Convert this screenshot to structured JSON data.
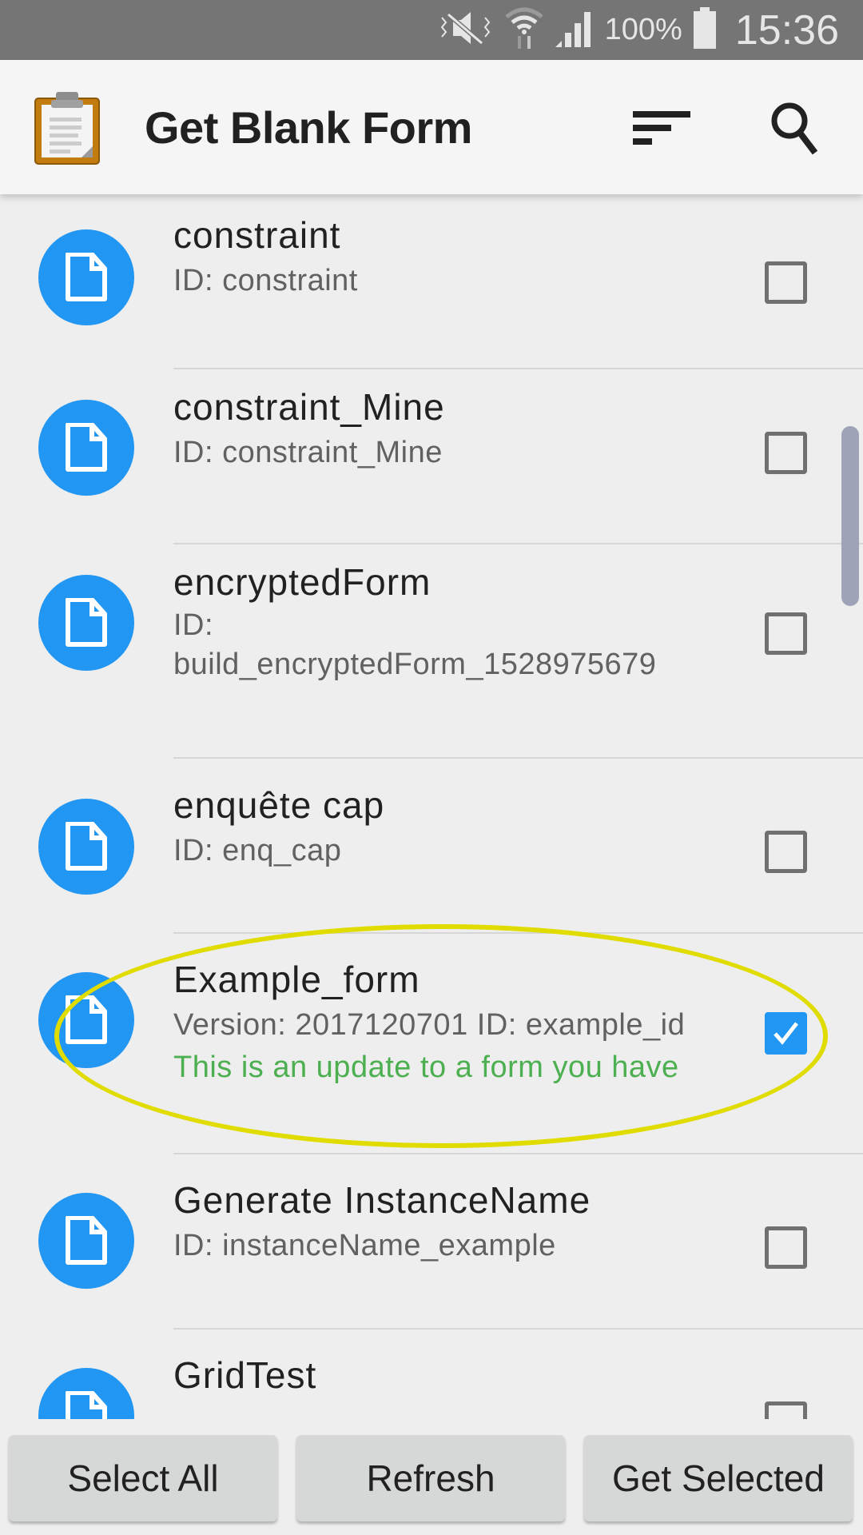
{
  "status_bar": {
    "icons": [
      "vibrate-mute-icon",
      "wifi-icon",
      "signal-icon",
      "battery-icon"
    ],
    "battery": "100%",
    "time": "15:36"
  },
  "app_bar": {
    "title": "Get Blank Form",
    "icon": "clipboard-icon",
    "actions": [
      "sort-icon",
      "search-icon"
    ]
  },
  "forms": [
    {
      "name": "constraint",
      "detail": "ID: constraint",
      "checked": false
    },
    {
      "name": "constraint_Mine",
      "detail": "ID: constraint_Mine",
      "checked": false
    },
    {
      "name": "encryptedForm",
      "detail_line1": "ID:",
      "detail_line2": "build_encryptedForm_1528975679",
      "checked": false
    },
    {
      "name": "enquête cap",
      "detail": "ID: enq_cap",
      "checked": false
    },
    {
      "name": "Example_form",
      "detail": "Version: 2017120701 ID: example_id",
      "note": "This is an update to a form you have",
      "checked": true
    },
    {
      "name": "Generate InstanceName",
      "detail": "ID: instanceName_example",
      "checked": false
    },
    {
      "name": "GridTest",
      "checked": false
    }
  ],
  "colors": {
    "accent": "#2196f3",
    "update_note": "#4caf50",
    "highlight_ellipse": "#e0dc00"
  },
  "buttons": {
    "select_all": "Select All",
    "refresh": "Refresh",
    "get_selected": "Get Selected"
  }
}
